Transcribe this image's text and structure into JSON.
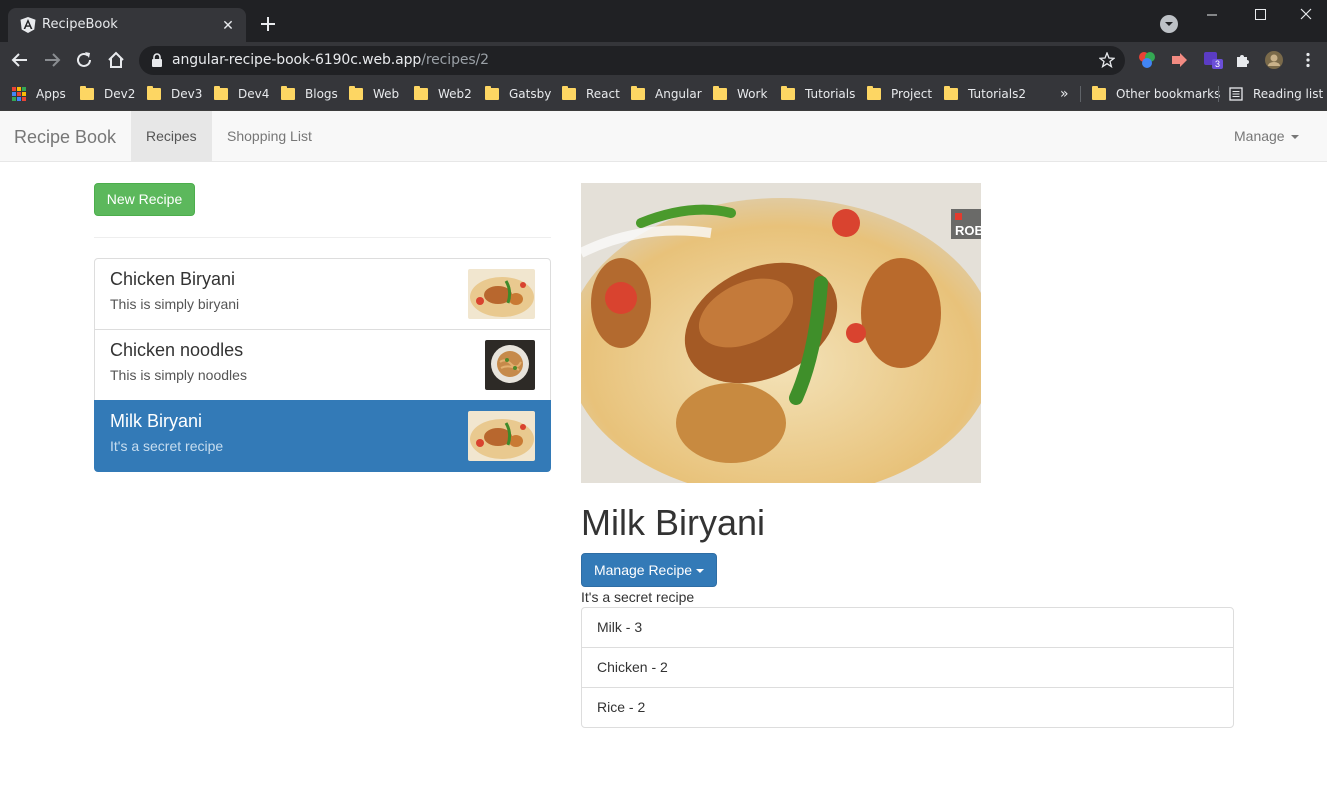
{
  "browser": {
    "tab_title": "RecipeBook",
    "url_host": "angular-recipe-book-6190c.web.app",
    "url_path": "/recipes/2",
    "extension_badge": "3",
    "bookmarks": [
      "Apps",
      "Dev2",
      "Dev3",
      "Dev4",
      "Blogs",
      "Web",
      "Web2",
      "Gatsby",
      "React",
      "Angular",
      "Work",
      "Tutorials",
      "Project",
      "Tutorials2"
    ],
    "bookmarks_overflow": "»",
    "other_bookmarks": "Other bookmarks",
    "reading_list": "Reading list"
  },
  "navbar": {
    "brand": "Recipe Book",
    "links": [
      "Recipes",
      "Shopping List"
    ],
    "active_link": "Recipes",
    "manage": "Manage"
  },
  "recipes": {
    "new_button": "New Recipe",
    "items": [
      {
        "name": "Chicken Biryani",
        "description": "This is simply biryani",
        "thumb": "biryani"
      },
      {
        "name": "Chicken noodles",
        "description": "This is simply noodles",
        "thumb": "noodles"
      },
      {
        "name": "Milk Biryani",
        "description": "It's a secret recipe",
        "thumb": "biryani",
        "active": true
      }
    ]
  },
  "detail": {
    "title": "Milk Biryani",
    "manage_button": "Manage Recipe",
    "description": "It's a secret recipe",
    "image_watermark": "ROB",
    "ingredients": [
      "Milk - 3",
      "Chicken - 2",
      "Rice - 2"
    ]
  },
  "colors": {
    "primary": "#337ab7",
    "success": "#5cb85c",
    "chrome_dark": "#202124",
    "chrome_toolbar": "#35363a"
  }
}
